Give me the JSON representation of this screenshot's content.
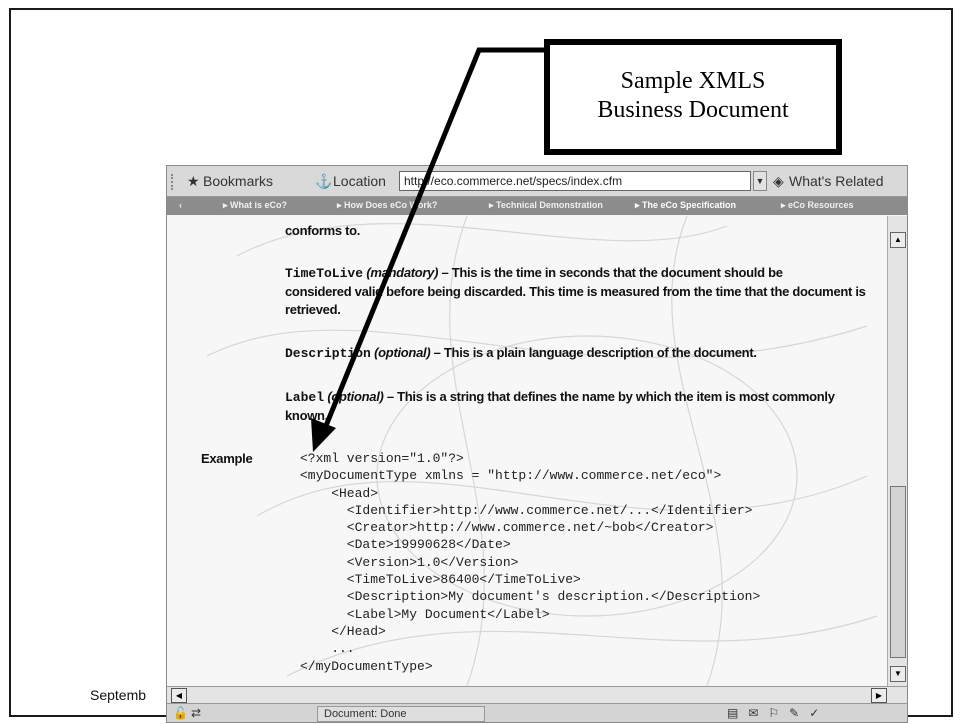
{
  "callout": {
    "line1": "Sample XMLS",
    "line2": "Business Document"
  },
  "footer": {
    "text": "Septemb"
  },
  "browser": {
    "toolbar": {
      "bookmarks_label": "Bookmarks",
      "location_label": "Location",
      "location_value": "http://eco.commerce.net/specs/index.cfm",
      "whats_related_label": "What's Related"
    },
    "nav": {
      "back": "‹",
      "items": [
        "▸ What is eCo?",
        "▸ How Does eCo Work?",
        "▸ Technical Demonstration",
        "▸ The eCo Specification",
        "▸ eCo Resources"
      ]
    },
    "content": {
      "p0": "conforms to.",
      "p1_term": "TimeToLive",
      "p1_tag": "(mandatory)",
      "p1_line1": " – This is the time in seconds that the document should be",
      "p1_line2": "considered valid before being discarded. This time is measured from the time that the document is",
      "p1_line3": "retrieved.",
      "p2_term": "Description",
      "p2_tag": "(optional)",
      "p2_text": " – This is a plain language description of the document.",
      "p3_term": "Label",
      "p3_tag": "(optional)",
      "p3_line1": " – This is a string that defines the name by which the item is most commonly",
      "p3_line2": "known.",
      "example_label": "Example",
      "code_lines": [
        "<?xml version=\"1.0\"?>",
        "<myDocumentType xmlns = \"http://www.commerce.net/eco\">",
        "    <Head>",
        "      <Identifier>http://www.commerce.net/...</Identifier>",
        "      <Creator>http://www.commerce.net/~bob</Creator>",
        "      <Date>19990628</Date>",
        "      <Version>1.0</Version>",
        "      <TimeToLive>86400</TimeToLive>",
        "      <Description>My document's description.</Description>",
        "      <Label>My Document</Label>",
        "    </Head>",
        "    ...",
        "</myDocumentType>"
      ]
    },
    "status": {
      "text": "Document: Done"
    }
  }
}
